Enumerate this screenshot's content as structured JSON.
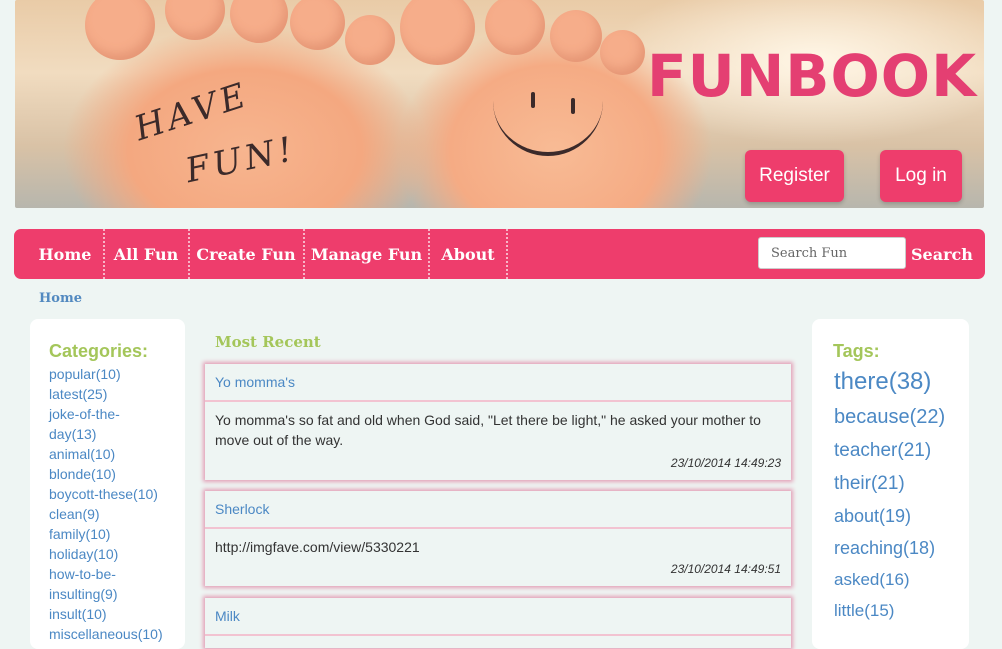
{
  "banner": {
    "brand": "FUNBOOK",
    "sole_left_line1": "HAVE",
    "sole_left_line2": "FUN!",
    "register_label": "Register",
    "login_label": "Log in"
  },
  "nav": {
    "items": [
      {
        "label": "Home"
      },
      {
        "label": "All Fun"
      },
      {
        "label": "Create Fun"
      },
      {
        "label": "Manage Fun"
      },
      {
        "label": "About"
      }
    ],
    "search_placeholder": "Search Fun",
    "search_label": "Search"
  },
  "breadcrumb": "Home",
  "categories": {
    "title": "Categories:",
    "items": [
      "popular(10)",
      "latest(25)",
      "joke-of-the-day(13)",
      "animal(10)",
      "blonde(10)",
      "boycott-these(10)",
      "clean(9)",
      "family(10)",
      "holiday(10)",
      "how-to-be-insulting(9)",
      "insult(10)",
      "miscellaneous(10)"
    ]
  },
  "main": {
    "section_title": "Most Recent",
    "posts": [
      {
        "title": "Yo momma's",
        "body": "Yo momma's so fat and old when God said, \"Let there be light,\" he asked your mother to move out of the way.",
        "date": "23/10/2014 14:49:23"
      },
      {
        "title": "Sherlock",
        "body": "http://imgfave.com/view/5330221",
        "date": "23/10/2014 14:49:51"
      },
      {
        "title": "Milk",
        "body": "",
        "date": ""
      }
    ]
  },
  "tags": {
    "title": "Tags:",
    "items": [
      "there(38)",
      "because(22)",
      "teacher(21)",
      "their(21)",
      "about(19)",
      "reaching(18)",
      "asked(16)",
      "little(15)"
    ]
  },
  "colors": {
    "accent": "#ee3d6c",
    "brand": "#e43f72",
    "heading_green": "#a4c65a",
    "link_blue": "#4b88c4"
  }
}
